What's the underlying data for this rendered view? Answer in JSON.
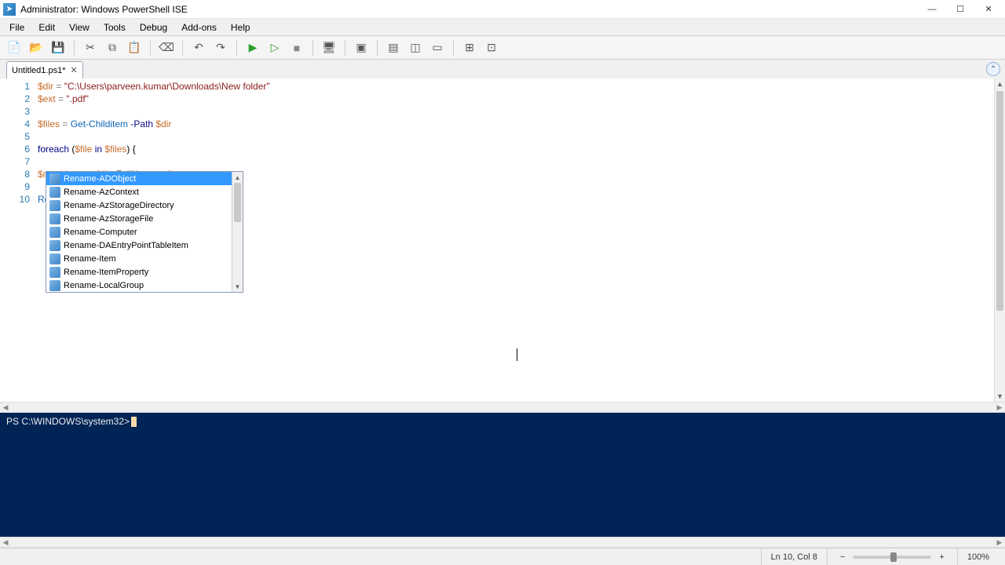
{
  "window": {
    "title": "Administrator: Windows PowerShell ISE"
  },
  "menu": {
    "file": "File",
    "edit": "Edit",
    "view": "View",
    "tools": "Tools",
    "debug": "Debug",
    "addons": "Add-ons",
    "help": "Help"
  },
  "tab": {
    "name": "Untitled1.ps1*"
  },
  "code": {
    "l1_var": "$dir",
    "l1_eq": " = ",
    "l1_str": "\"C:\\Users\\parveen.kumar\\Downloads\\New folder\"",
    "l2_var": "$ext",
    "l2_eq": " = ",
    "l2_str": "\".pdf\"",
    "l4_var": "$files",
    "l4_eq": " = ",
    "l4_cmd": "Get-Childitem",
    "l4_par": " -Path ",
    "l4_arg": "$dir",
    "l6_kw": "foreach",
    "l6_open": " (",
    "l6_v1": "$file",
    "l6_in": " in ",
    "l6_v2": "$files",
    "l6_close": ") {",
    "l8_var": "$newName",
    "l8_eq": " = ",
    "l8_v1": "$file",
    "l8_dot": ".",
    "l8_prop": "FullName",
    "l8_plus": " + ",
    "l8_v2": "$ext",
    "l10": "Rename-"
  },
  "gutter": {
    "1": "1",
    "2": "2",
    "3": "3",
    "4": "4",
    "5": "5",
    "6": "6",
    "7": "7",
    "8": "8",
    "9": "9",
    "10": "10"
  },
  "intellisense": {
    "items": {
      "0": "Rename-ADObject",
      "1": "Rename-AzContext",
      "2": "Rename-AzStorageDirectory",
      "3": "Rename-AzStorageFile",
      "4": "Rename-Computer",
      "5": "Rename-DAEntryPointTableItem",
      "6": "Rename-Item",
      "7": "Rename-ItemProperty",
      "8": "Rename-LocalGroup"
    }
  },
  "console": {
    "prompt": "PS C:\\WINDOWS\\system32>"
  },
  "status": {
    "position": "Ln 10, Col 8",
    "zoom": "100%"
  }
}
